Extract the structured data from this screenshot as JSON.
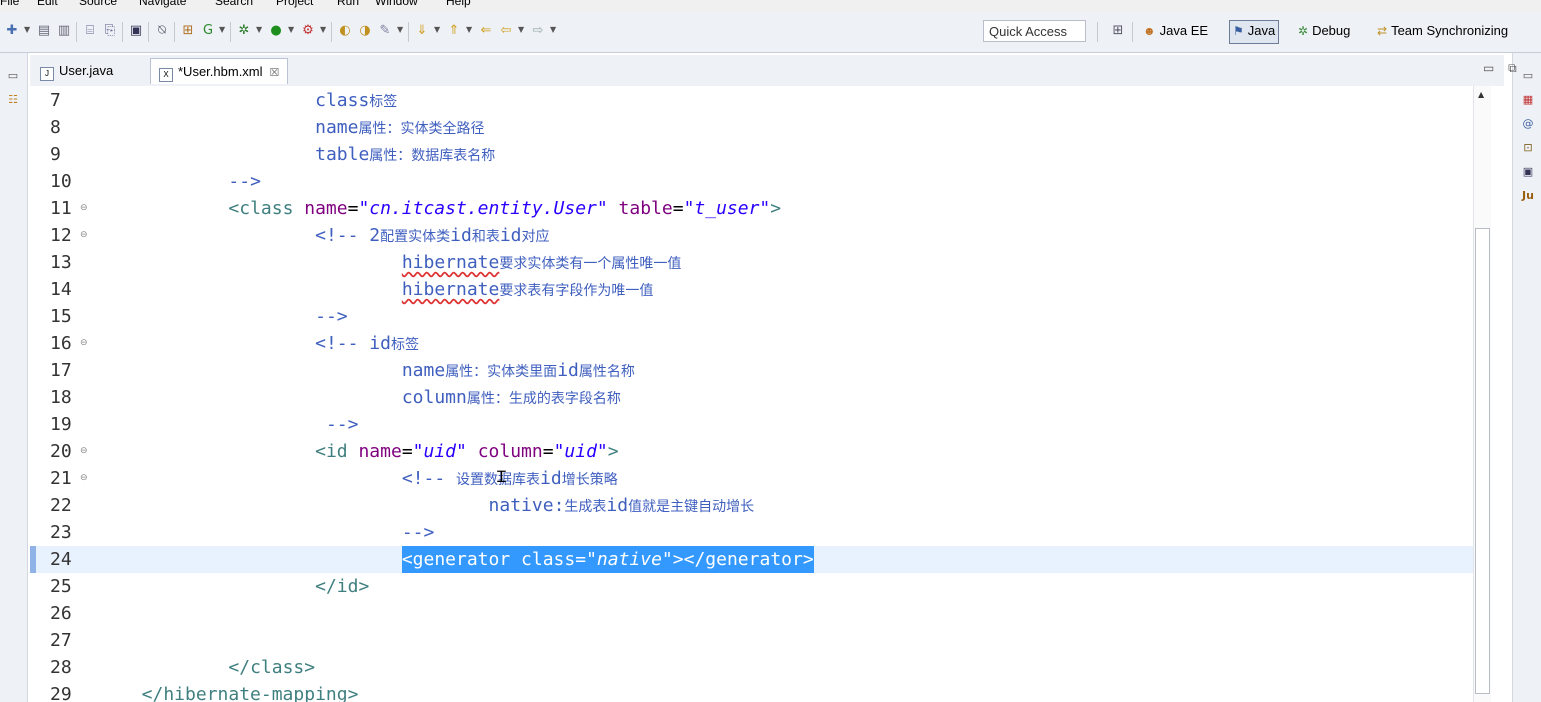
{
  "menu": [
    "File",
    "Edit",
    "Source",
    "Navigate",
    "Search",
    "Project",
    "Run",
    "Window",
    "Help"
  ],
  "toolbar": {
    "quick_access": "Quick Access"
  },
  "perspectives": [
    {
      "label": "Java EE",
      "icon": "java-ee-perspective-icon",
      "glyph": "☻"
    },
    {
      "label": "Java",
      "icon": "java-perspective-icon",
      "glyph": "⚑",
      "active": true
    },
    {
      "label": "Debug",
      "icon": "debug-bug-icon",
      "glyph": "✲"
    },
    {
      "label": "Team Synchronizing",
      "icon": "team-sync-icon",
      "glyph": "⇄"
    }
  ],
  "tabs": [
    {
      "label": "User.java",
      "icon": "java-file-icon",
      "glyph": "J",
      "active": false
    },
    {
      "label": "*User.hbm.xml",
      "icon": "xml-file-icon",
      "glyph": "X",
      "active": true,
      "close": "☒"
    }
  ],
  "editor": {
    "lines": [
      {
        "num": "7",
        "indent": 18,
        "tokens": [
          [
            "c-comment",
            "class"
          ],
          [
            "c-cn",
            "标签"
          ]
        ]
      },
      {
        "num": "8",
        "indent": 18,
        "tokens": [
          [
            "c-comment",
            "name"
          ],
          [
            "c-cn",
            "属性：实体类全路径"
          ]
        ]
      },
      {
        "num": "9",
        "indent": 18,
        "tokens": [
          [
            "c-comment",
            "table"
          ],
          [
            "c-cn",
            "属性：数据库表名称"
          ]
        ]
      },
      {
        "num": "10",
        "indent": 10,
        "tokens": [
          [
            "c-comment",
            "-->"
          ]
        ]
      },
      {
        "num": "11",
        "indent": 10,
        "fold": true,
        "tokens": [
          [
            "c-tag",
            "<class "
          ],
          [
            "c-attr",
            "name"
          ],
          [
            "c-plain",
            "="
          ],
          [
            "c-str",
            "\"cn.itcast.entity.User\""
          ],
          [
            "c-plain",
            " "
          ],
          [
            "c-attr",
            "table"
          ],
          [
            "c-plain",
            "="
          ],
          [
            "c-str",
            "\"t_user\""
          ],
          [
            "c-tag",
            ">"
          ]
        ]
      },
      {
        "num": "12",
        "indent": 18,
        "fold": true,
        "tokens": [
          [
            "c-comment",
            "<!-- 2"
          ],
          [
            "c-cn",
            "配置实体类"
          ],
          [
            "c-comment",
            "id"
          ],
          [
            "c-cn",
            "和表"
          ],
          [
            "c-comment",
            "id"
          ],
          [
            "c-cn",
            "对应"
          ]
        ]
      },
      {
        "num": "13",
        "indent": 26,
        "tokens": [
          [
            "c-comment squiggle",
            "hibernate"
          ],
          [
            "c-cn",
            "要求实体类有一个属性唯一值"
          ]
        ]
      },
      {
        "num": "14",
        "indent": 26,
        "tokens": [
          [
            "c-comment squiggle",
            "hibernate"
          ],
          [
            "c-cn",
            "要求表有字段作为唯一值"
          ]
        ]
      },
      {
        "num": "15",
        "indent": 18,
        "tokens": [
          [
            "c-comment",
            "-->"
          ]
        ]
      },
      {
        "num": "16",
        "indent": 18,
        "fold": true,
        "tokens": [
          [
            "c-comment",
            "<!-- id"
          ],
          [
            "c-cn",
            "标签"
          ]
        ]
      },
      {
        "num": "17",
        "indent": 26,
        "tokens": [
          [
            "c-comment",
            "name"
          ],
          [
            "c-cn",
            "属性：实体类里面"
          ],
          [
            "c-comment",
            "id"
          ],
          [
            "c-cn",
            "属性名称"
          ]
        ]
      },
      {
        "num": "18",
        "indent": 26,
        "tokens": [
          [
            "c-comment",
            "column"
          ],
          [
            "c-cn",
            "属性：生成的表字段名称"
          ]
        ]
      },
      {
        "num": "19",
        "indent": 19,
        "tokens": [
          [
            "c-comment",
            "-->"
          ]
        ]
      },
      {
        "num": "20",
        "indent": 18,
        "fold": true,
        "tokens": [
          [
            "c-tag",
            "<id "
          ],
          [
            "c-attr",
            "name"
          ],
          [
            "c-plain",
            "="
          ],
          [
            "c-str",
            "\"uid\""
          ],
          [
            "c-plain",
            " "
          ],
          [
            "c-attr",
            "column"
          ],
          [
            "c-plain",
            "="
          ],
          [
            "c-str",
            "\"uid\""
          ],
          [
            "c-tag",
            ">"
          ]
        ]
      },
      {
        "num": "21",
        "indent": 26,
        "fold": true,
        "tokens": [
          [
            "c-comment",
            "<!-- "
          ],
          [
            "c-cn",
            "设置数据库表"
          ],
          [
            "c-comment",
            "id"
          ],
          [
            "c-cn",
            "增长策略"
          ]
        ]
      },
      {
        "num": "22",
        "indent": 34,
        "tokens": [
          [
            "c-comment",
            "native:"
          ],
          [
            "c-cn",
            "生成表"
          ],
          [
            "c-comment",
            "id"
          ],
          [
            "c-cn",
            "值就是主键自动增长"
          ]
        ]
      },
      {
        "num": "23",
        "indent": 26,
        "tokens": [
          [
            "c-comment",
            "-->"
          ]
        ]
      },
      {
        "num": "24",
        "indent": 26,
        "current": true,
        "selected": true,
        "tokens": [
          [
            "c-tag",
            "<generator "
          ],
          [
            "c-attr",
            "class"
          ],
          [
            "c-plain",
            "="
          ],
          [
            "c-str",
            "\"native\""
          ],
          [
            "c-tag",
            "></generator>"
          ]
        ]
      },
      {
        "num": "25",
        "indent": 18,
        "tokens": [
          [
            "c-tag",
            "</id>"
          ]
        ]
      },
      {
        "num": "26",
        "indent": 0,
        "tokens": []
      },
      {
        "num": "27",
        "indent": 0,
        "tokens": []
      },
      {
        "num": "28",
        "indent": 10,
        "tokens": [
          [
            "c-tag",
            "</class>"
          ]
        ]
      },
      {
        "num": "29",
        "indent": 2,
        "tokens": [
          [
            "c-tag",
            "</hibernate-mapping>"
          ]
        ]
      }
    ]
  }
}
